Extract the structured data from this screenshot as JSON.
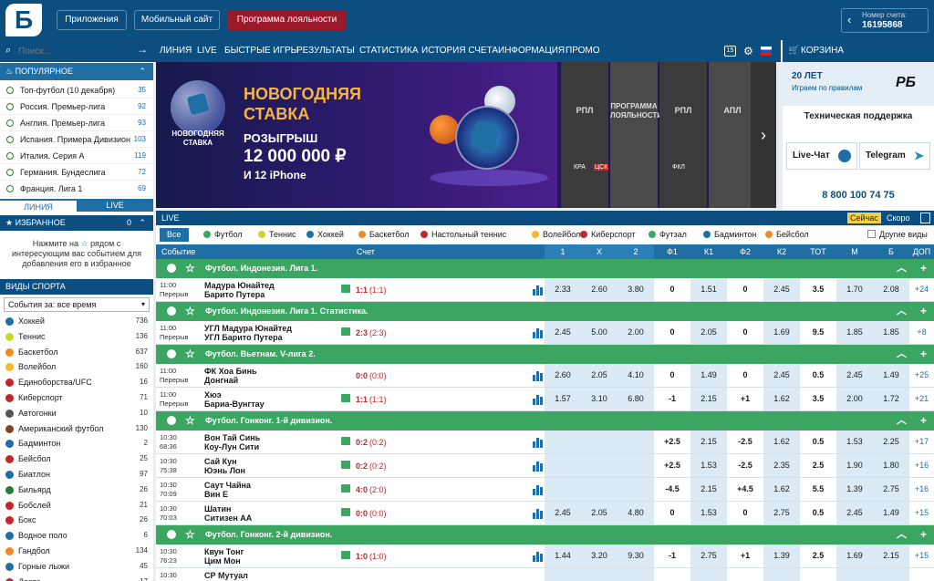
{
  "header": {
    "logo": "Б",
    "apps": "Приложения",
    "mobile": "Мобильный сайт",
    "loyalty": "Программа лояльности",
    "account_label": "Номер счета:",
    "account_number": "16195868"
  },
  "sidebar": {
    "search_placeholder": "Поиск...",
    "popular_title": "ПОПУЛЯРНОЕ",
    "popular": [
      {
        "name": "Топ-футбол (10 декабря)",
        "count": "35"
      },
      {
        "name": "Россия. Премьер-лига",
        "count": "92"
      },
      {
        "name": "Англия. Премьер-лига",
        "count": "93"
      },
      {
        "name": "Испания. Примера Дивизион",
        "count": "103"
      },
      {
        "name": "Италия. Серия А",
        "count": "119"
      },
      {
        "name": "Германия. Бундеслига",
        "count": "72"
      },
      {
        "name": "Франция. Лига 1",
        "count": "69"
      }
    ],
    "tab_line": "ЛИНИЯ",
    "tab_live": "LIVE",
    "fav_title": "ИЗБРАННОЕ",
    "fav_count": "0",
    "fav_text_1": "Нажмите на",
    "fav_text_2": "рядом с интересующим вас событием для добавления его в избранное",
    "sports_title": "ВИДЫ СПОРТА",
    "period_select": "События за: все время",
    "sports": [
      {
        "name": "Хоккей",
        "count": "736",
        "color": "#1f6fa5"
      },
      {
        "name": "Теннис",
        "count": "136",
        "color": "#c9d82a"
      },
      {
        "name": "Баскетбол",
        "count": "637",
        "color": "#f08a24"
      },
      {
        "name": "Волейбол",
        "count": "160",
        "color": "#f3b72a"
      },
      {
        "name": "Единоборства/UFC",
        "count": "16",
        "color": "#c0262c"
      },
      {
        "name": "Киберспорт",
        "count": "71",
        "color": "#c0262c"
      },
      {
        "name": "Автогонки",
        "count": "10",
        "color": "#555555"
      },
      {
        "name": "Американский футбол",
        "count": "130",
        "color": "#7a4a1c"
      },
      {
        "name": "Бадминтон",
        "count": "2",
        "color": "#1f6fa5"
      },
      {
        "name": "Бейсбол",
        "count": "25",
        "color": "#c0262c"
      },
      {
        "name": "Биатлон",
        "count": "97",
        "color": "#1f6fa5"
      },
      {
        "name": "Бильярд",
        "count": "26",
        "color": "#2a7a3a"
      },
      {
        "name": "Бобслей",
        "count": "21",
        "color": "#c0262c"
      },
      {
        "name": "Бокс",
        "count": "26",
        "color": "#c0262c"
      },
      {
        "name": "Водное поло",
        "count": "6",
        "color": "#1f6fa5"
      },
      {
        "name": "Гандбол",
        "count": "134",
        "color": "#f08a24"
      },
      {
        "name": "Горные лыжи",
        "count": "45",
        "color": "#1f6fa5"
      },
      {
        "name": "Дартс",
        "count": "17",
        "color": "#c0262c"
      }
    ]
  },
  "nav": {
    "items": [
      "ЛИНИЯ",
      "LIVE",
      "БЫСТРЫЕ ИГРЫ",
      "РЕЗУЛЬТАТЫ",
      "СТАТИСТИКА",
      "ИСТОРИЯ СЧЕТА",
      "ИНФОРМАЦИЯ",
      "ПРОМО"
    ],
    "badge": "15"
  },
  "banner": {
    "ball_label_1": "НОВОГОДНЯЯ",
    "ball_label_2": "СТАВКА",
    "title_1": "НОВОГОДНЯЯ",
    "title_2": "СТАВКА",
    "sub": "РОЗЫГРЫШ",
    "amount": "12 000 000 ₽",
    "extra": "И 12 iPhone",
    "cards": [
      {
        "t1": "РПЛ",
        "t2": "",
        "b1": "КРА",
        "b2": "ЦСК"
      },
      {
        "t1": "ПРОГРАММА",
        "t2": "ЛОЯЛЬНОСТИ",
        "b1": "",
        "b2": ""
      },
      {
        "t1": "РПЛ",
        "t2": "",
        "b1": "ФКЛ",
        "b2": ""
      },
      {
        "t1": "АПЛ",
        "t2": "",
        "b1": "",
        "b2": ""
      }
    ],
    "next": "›"
  },
  "right": {
    "cart": "КОРЗИНА",
    "promo_1": "20 ЛЕТ",
    "promo_2": "Играем по правилам",
    "promo_logo": "РБ",
    "support_title": "Техническая поддержка",
    "livechat": "Live-Чат",
    "telegram": "Telegram",
    "phone": "8 800 100 74 75"
  },
  "live": {
    "title": "LIVE",
    "now": "Сейчас",
    "soon": "Скоро",
    "other": "Другие виды",
    "filters": [
      "Все",
      "Футбол",
      "Теннис",
      "Хоккей",
      "Баскетбол",
      "Настольный теннис",
      "Волейбол",
      "Киберспорт",
      "Футзал",
      "Бадминтон",
      "Бейсбол"
    ],
    "columns": [
      "Событие",
      "Счет",
      "1",
      "X",
      "2",
      "Ф1",
      "К1",
      "Ф2",
      "К2",
      "ТОТ",
      "М",
      "Б",
      "ДОП"
    ],
    "leagues": [
      {
        "name": "Футбол. Индонезия. Лига 1.",
        "events": [
          {
            "time": "11:00",
            "status": "Перерыв",
            "home": "Мадура Юнайтед",
            "away": "Барито Путера",
            "tv": true,
            "score": "1:1",
            "sub": "(1:1)",
            "odds": [
              "2.33",
              "2.60",
              "3.80",
              "0",
              "1.51",
              "0",
              "2.45",
              "3.5",
              "1.70",
              "2.08",
              "+24"
            ]
          }
        ]
      },
      {
        "name": "Футбол. Индонезия. Лига 1. Статистика.",
        "events": [
          {
            "time": "11:00",
            "status": "Перерыв",
            "home": "УГЛ Мадура Юнайтед",
            "away": "УГЛ Барито Путера",
            "tv": true,
            "score": "2:3",
            "sub": "(2:3)",
            "odds": [
              "2.45",
              "5.00",
              "2.00",
              "0",
              "2.05",
              "0",
              "1.69",
              "9.5",
              "1.85",
              "1.85",
              "+8"
            ]
          }
        ]
      },
      {
        "name": "Футбол. Вьетнам. V-лига 2.",
        "events": [
          {
            "time": "11:00",
            "status": "Перерыв",
            "home": "ФК Хоа Бинь",
            "away": "Донгнай",
            "tv": false,
            "score": "0:0",
            "sub": "(0:0)",
            "odds": [
              "2.60",
              "2.05",
              "4.10",
              "0",
              "1.49",
              "0",
              "2.45",
              "0.5",
              "2.45",
              "1.49",
              "+25"
            ]
          },
          {
            "time": "11:00",
            "status": "Перерыв",
            "home": "Хюэ",
            "away": "Бариа-Вунгтау",
            "tv": true,
            "score": "1:1",
            "sub": "(1:1)",
            "odds": [
              "1.57",
              "3.10",
              "6.80",
              "-1",
              "2.15",
              "+1",
              "1.62",
              "3.5",
              "2.00",
              "1.72",
              "+21"
            ]
          }
        ]
      },
      {
        "name": "Футбол. Гонконг. 1-й дивизион.",
        "events": [
          {
            "time": "10:30",
            "status": "68:36",
            "home": "Вон Тай Синь",
            "away": "Коу-Лун Сити",
            "tv": true,
            "score": "0:2",
            "sub": "(0:2)",
            "odds": [
              "",
              "",
              "",
              "+2.5",
              "2.15",
              "-2.5",
              "1.62",
              "0.5",
              "1.53",
              "2.25",
              "+17"
            ]
          },
          {
            "time": "10:30",
            "status": "75:38",
            "home": "Сай Кун",
            "away": "Юэнь Лон",
            "tv": true,
            "score": "0:2",
            "sub": "(0:2)",
            "odds": [
              "",
              "",
              "",
              "+2.5",
              "1.53",
              "-2.5",
              "2.35",
              "2.5",
              "1.90",
              "1.80",
              "+16"
            ]
          },
          {
            "time": "10:30",
            "status": "70:09",
            "home": "Саут Чайна",
            "away": "Вин Е",
            "tv": true,
            "score": "4:0",
            "sub": "(2:0)",
            "odds": [
              "",
              "",
              "",
              "-4.5",
              "2.15",
              "+4.5",
              "1.62",
              "5.5",
              "1.39",
              "2.75",
              "+16"
            ]
          },
          {
            "time": "10:30",
            "status": "70:03",
            "home": "Шатин",
            "away": "Ситизен АА",
            "tv": true,
            "score": "0:0",
            "sub": "(0:0)",
            "odds": [
              "2.45",
              "2.05",
              "4.80",
              "0",
              "1.53",
              "0",
              "2.75",
              "0.5",
              "2.45",
              "1.49",
              "+15"
            ]
          }
        ]
      },
      {
        "name": "Футбол. Гонконг. 2-й дивизион.",
        "events": [
          {
            "time": "10:30",
            "status": "76:23",
            "home": "Квун Тонг",
            "away": "Цим Мон",
            "tv": true,
            "score": "1:0",
            "sub": "(1:0)",
            "odds": [
              "1.44",
              "3.20",
              "9.30",
              "-1",
              "2.75",
              "+1",
              "1.39",
              "2.5",
              "1.69",
              "2.15",
              "+15"
            ]
          },
          {
            "time": "10:30",
            "status": "",
            "home": "СР Мутуал",
            "away": "",
            "tv": false,
            "score": "",
            "sub": "",
            "odds": [
              "",
              "",
              "",
              "",
              "",
              "",
              "",
              "",
              "",
              "",
              ""
            ]
          }
        ]
      }
    ]
  },
  "colors": {
    "primary": "#0d4e80",
    "green": "#3aa662",
    "highlight": "#dbeaf5"
  }
}
